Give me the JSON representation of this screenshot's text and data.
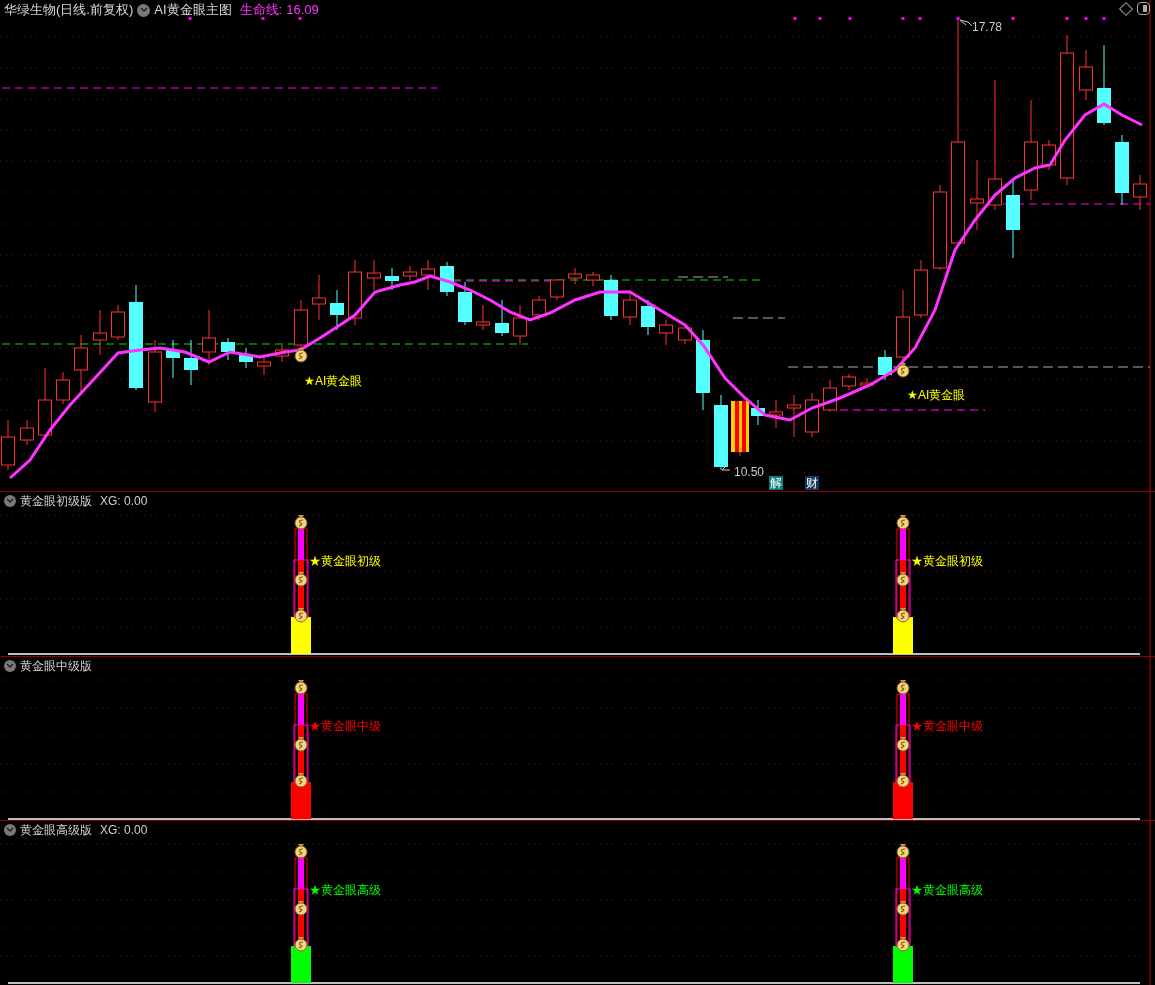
{
  "header": {
    "stock": "华绿生物(日线.前复权)",
    "indicator": "AI黄金眼主图",
    "line_name": "生命线:",
    "line_value": "16.09"
  },
  "main_chart": {
    "high_label": "17.78",
    "low_label": "10.50",
    "signals": [
      {
        "label": "★AI黄金眼"
      },
      {
        "label": "★AI黄金眼"
      }
    ],
    "badges": [
      {
        "label": "解",
        "color": "#0b7d7d"
      },
      {
        "label": "财",
        "color": "#12395c"
      }
    ]
  },
  "panels": [
    {
      "title": "黄金眼初级版",
      "xg": "XG: 0.00",
      "color": "#ffff00",
      "signals": [
        {
          "label": "★黄金眼初级"
        },
        {
          "label": "★黄金眼初级"
        }
      ]
    },
    {
      "title": "黄金眼中级版",
      "color": "#ff0000",
      "signals": [
        {
          "label": "★黄金眼中级"
        },
        {
          "label": "★黄金眼中级"
        }
      ]
    },
    {
      "title": "黄金眼高级版",
      "xg": "XG: 0.00",
      "color": "#00ff00",
      "signals": [
        {
          "label": "★黄金眼高级"
        },
        {
          "label": "★黄金眼高级"
        }
      ]
    }
  ]
}
